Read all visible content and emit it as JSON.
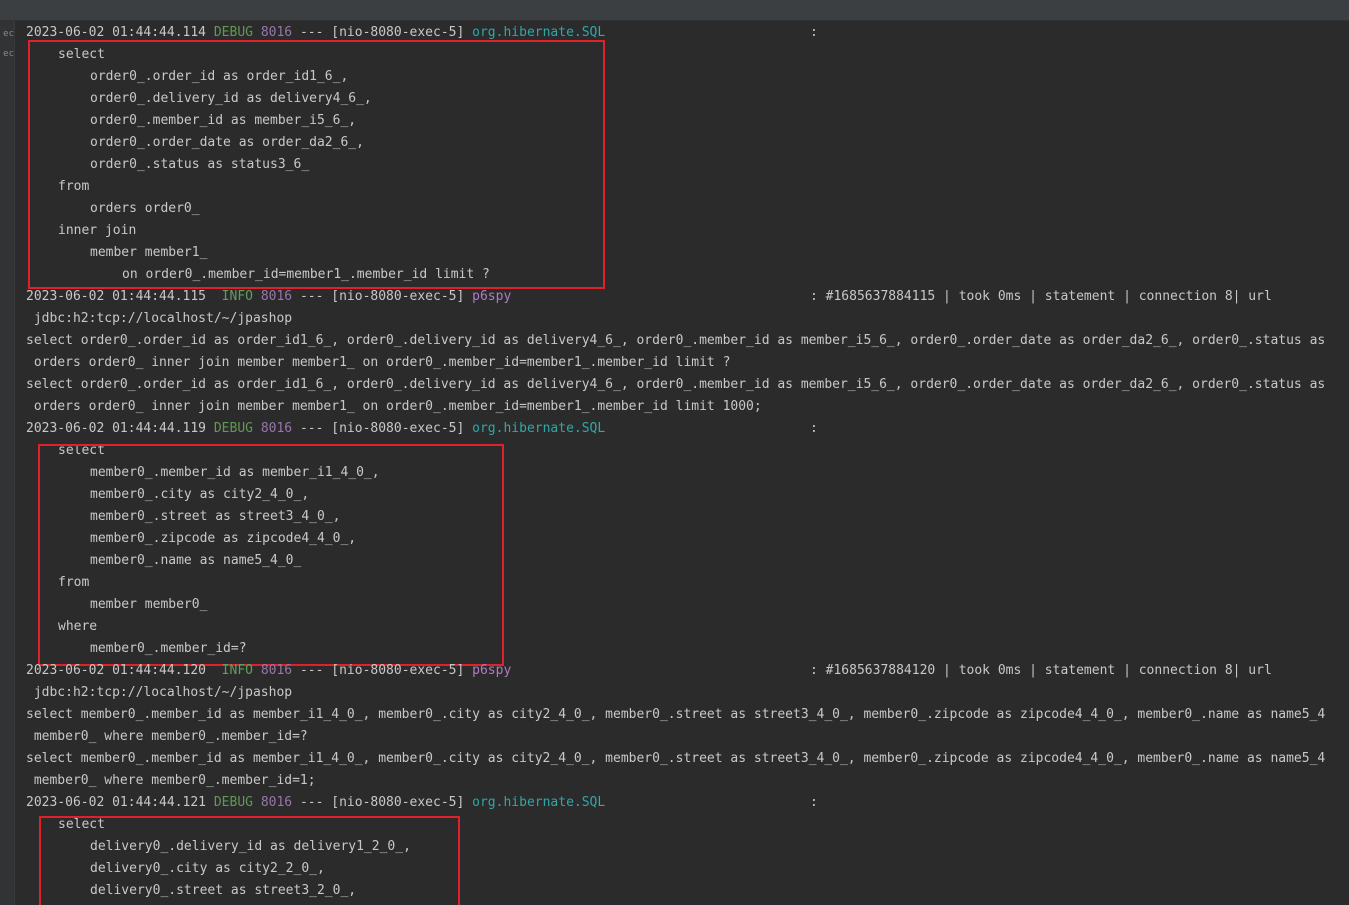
{
  "gutter": {
    "marks": [
      "ec",
      "ec"
    ]
  },
  "log": {
    "entry1": {
      "timestamp": "2023-06-02 01:44:44.114",
      "level": "DEBUG",
      "pid": "8016",
      "sep": "---",
      "thread": "[nio-8080-exec-5]",
      "logger": "org.hibernate.SQL",
      "colon": ":",
      "sql": [
        "select",
        "order0_.order_id as order_id1_6_,",
        "order0_.delivery_id as delivery4_6_,",
        "order0_.member_id as member_i5_6_,",
        "order0_.order_date as order_da2_6_,",
        "order0_.status as status3_6_",
        "from",
        "orders order0_",
        "inner join",
        "member member1_",
        "on order0_.member_id=member1_.member_id limit ?"
      ]
    },
    "entry2": {
      "timestamp": "2023-06-02 01:44:44.115",
      "level": "INFO",
      "pid": "8016",
      "sep": "---",
      "thread": "[nio-8080-exec-5]",
      "logger": "p6spy",
      "message": ": #1685637884115 | took 0ms | statement | connection 8| url",
      "lines": [
        " jdbc:h2:tcp://localhost/~/jpashop",
        "select order0_.order_id as order_id1_6_, order0_.delivery_id as delivery4_6_, order0_.member_id as member_i5_6_, order0_.order_date as order_da2_6_, order0_.status as",
        " orders order0_ inner join member member1_ on order0_.member_id=member1_.member_id limit ?",
        "select order0_.order_id as order_id1_6_, order0_.delivery_id as delivery4_6_, order0_.member_id as member_i5_6_, order0_.order_date as order_da2_6_, order0_.status as",
        " orders order0_ inner join member member1_ on order0_.member_id=member1_.member_id limit 1000;"
      ]
    },
    "entry3": {
      "timestamp": "2023-06-02 01:44:44.119",
      "level": "DEBUG",
      "pid": "8016",
      "sep": "---",
      "thread": "[nio-8080-exec-5]",
      "logger": "org.hibernate.SQL",
      "colon": ":",
      "sql": [
        "select",
        "member0_.member_id as member_i1_4_0_,",
        "member0_.city as city2_4_0_,",
        "member0_.street as street3_4_0_,",
        "member0_.zipcode as zipcode4_4_0_,",
        "member0_.name as name5_4_0_",
        "from",
        "member member0_",
        "where",
        "member0_.member_id=?"
      ]
    },
    "entry4": {
      "timestamp": "2023-06-02 01:44:44.120",
      "level": "INFO",
      "pid": "8016",
      "sep": "---",
      "thread": "[nio-8080-exec-5]",
      "logger": "p6spy",
      "message": ": #1685637884120 | took 0ms | statement | connection 8| url",
      "lines": [
        " jdbc:h2:tcp://localhost/~/jpashop",
        "select member0_.member_id as member_i1_4_0_, member0_.city as city2_4_0_, member0_.street as street3_4_0_, member0_.zipcode as zipcode4_4_0_, member0_.name as name5_4",
        " member0_ where member0_.member_id=?",
        "select member0_.member_id as member_i1_4_0_, member0_.city as city2_4_0_, member0_.street as street3_4_0_, member0_.zipcode as zipcode4_4_0_, member0_.name as name5_4",
        " member0_ where member0_.member_id=1;"
      ]
    },
    "entry5": {
      "timestamp": "2023-06-02 01:44:44.121",
      "level": "DEBUG",
      "pid": "8016",
      "sep": "---",
      "thread": "[nio-8080-exec-5]",
      "logger": "org.hibernate.SQL",
      "colon": ":",
      "sql": [
        "select",
        "delivery0_.delivery_id as delivery1_2_0_,",
        "delivery0_.city as city2_2_0_,",
        "delivery0_.street as street3_2_0_,"
      ]
    }
  }
}
